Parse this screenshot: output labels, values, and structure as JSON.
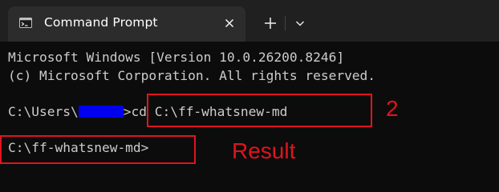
{
  "window": {
    "tab_title": "Command Prompt",
    "icons": {
      "tab": "command-prompt-icon",
      "close": "close-icon",
      "new_tab": "plus-icon",
      "dropdown": "chevron-down-icon"
    }
  },
  "terminal": {
    "lines": {
      "header_1": "Microsoft Windows [Version 10.0.26200.8246]",
      "header_2": "(c) Microsoft Corporation. All rights reserved.",
      "prompt_prefix": "C:\\Users\\",
      "prompt_suffix": ">",
      "command": "cd C:\\ff-whatsnew-md",
      "result_prompt": "C:\\ff-whatsnew-md>"
    },
    "colors": {
      "background": "#0c0c0c",
      "text": "#cccccc",
      "redaction": "#0000ee"
    }
  },
  "annotations": {
    "step_label": "2",
    "result_label": "Result",
    "color": "#e0141e"
  }
}
